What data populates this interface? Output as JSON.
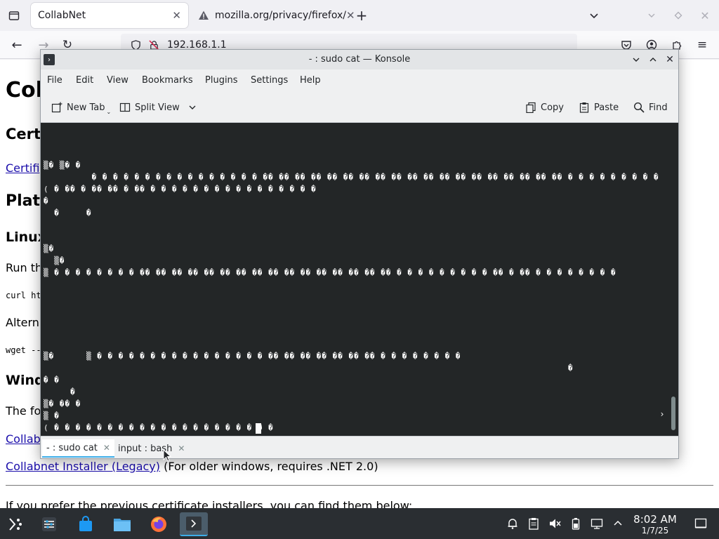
{
  "browser": {
    "tabs": [
      {
        "title": "CollabNet"
      },
      {
        "title": "mozilla.org/privacy/firefox/"
      }
    ],
    "url": "192.168.1.1"
  },
  "page": {
    "title": "Col",
    "cert_heading": "Cert",
    "cert_link": "Certifi",
    "platforms_heading": "Plat",
    "linux_heading": "Linux",
    "run_text": "Run th",
    "curl_text": "curl ht",
    "alt_text": "Altern",
    "wget_text": "wget --",
    "windows_heading": "Wind",
    "the_fo_text": "The fo",
    "collab_link": "Collab",
    "installer_legacy_link": "Collabnet Installer (Legacy)",
    "installer_legacy_note": " (For older windows, requires .NET 2.0)",
    "prev_installers_text": "If you prefer the previous certificate installers, you can find them below:"
  },
  "konsole": {
    "title": "- : sudo cat — Konsole",
    "menu": [
      "File",
      "Edit",
      "View",
      "Bookmarks",
      "Plugins",
      "Settings",
      "Help"
    ],
    "toolbar": {
      "new_tab": "New Tab",
      "split_view": "Split View",
      "copy": "Copy",
      "paste": "Paste",
      "find": "Find"
    },
    "terminal_lines": [
      "▒� ▒� �",
      "         � � � � � � � � � � � � � � � � �� �� �� �� �� �� �� �� �� �� �� �� �� �� �� �� �� �� �� � � � � � � � � �",
      "( � �� � �� �� � �� � � � � � � � � � � � � � � � �",
      "�",
      "  �     �",
      "",
      "",
      "▒�",
      "  ▒�",
      "▒ � � � � � � � � �� �� �� �� �� �� �� �� �� �� �� �� �� �� �� �� � � � � � � � � � �� � �� � � � � � � � �",
      "",
      "",
      "",
      "",
      "▒�      ▒ � � � � � � � � � � � � � � � � �� �� �� �� �� �� �� � � � � � � � �",
      "                                                                                                  �",
      "� �",
      "     �",
      "▒� �� �",
      "▒ �",
      "( � � � � � � � � � � � � � � � � � � � � �"
    ],
    "tabs": [
      {
        "label": "- : sudo cat"
      },
      {
        "label": "input : bash"
      }
    ]
  },
  "taskbar": {
    "time": "8:02 AM",
    "date": "1/7/25"
  },
  "colors": {
    "terminal_bg": "#232627",
    "taskbar_bg": "#2a2e32",
    "accent": "#3daee9",
    "link": "#1a0dab"
  }
}
